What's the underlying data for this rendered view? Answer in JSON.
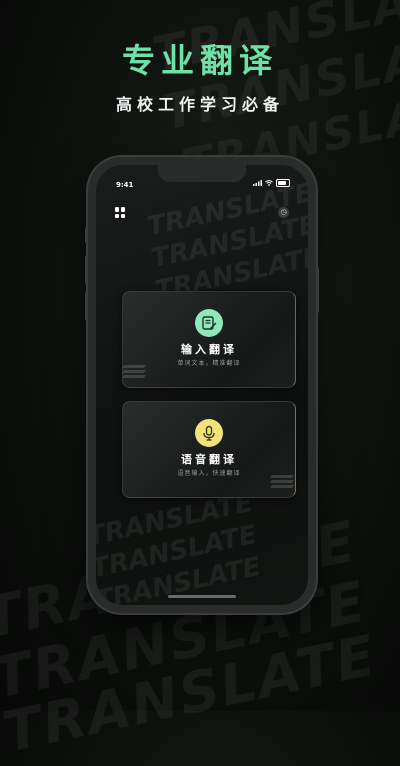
{
  "hero": {
    "title": "专业翻译",
    "subtitle": "高校工作学习必备"
  },
  "background_watermark": "TRANSLATE",
  "status_bar": {
    "time": "9:41"
  },
  "cards": [
    {
      "title": "输入翻译",
      "description": "单词文本，精准翻译",
      "icon": "notebook-pen-icon",
      "accent": "#8fe8b8"
    },
    {
      "title": "语音翻译",
      "description": "语音输入，快速翻译",
      "icon": "microphone-icon",
      "accent": "#f2e27a"
    }
  ],
  "colors": {
    "title_green": "#6fe0a8",
    "background": "#0d100d"
  }
}
